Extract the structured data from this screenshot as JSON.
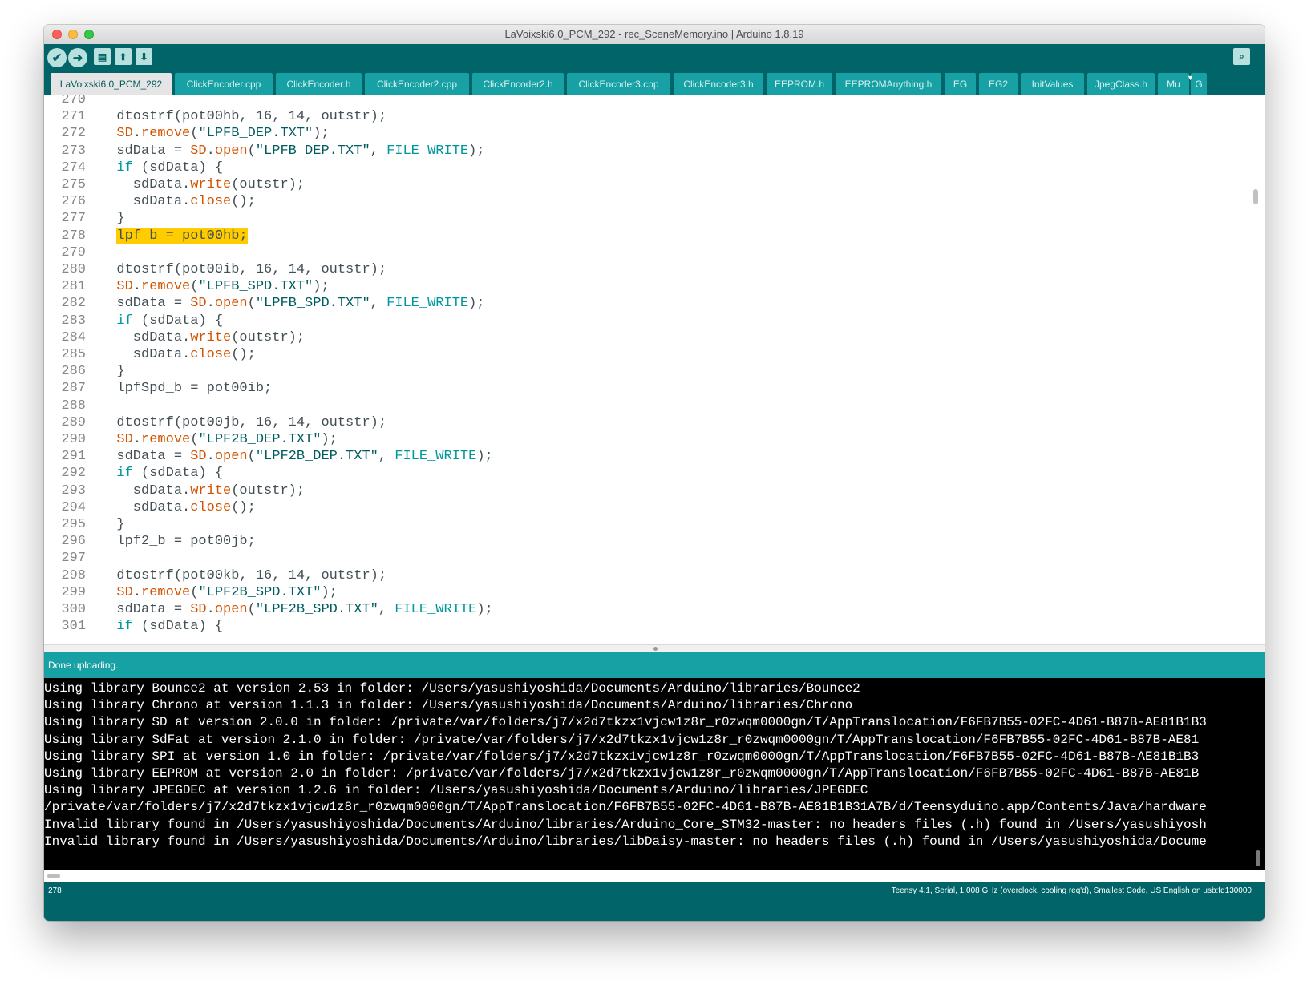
{
  "window": {
    "title": "LaVoixski6.0_PCM_292 - rec_SceneMemory.ino | Arduino 1.8.19"
  },
  "toolbar": {
    "verify_icon": "checkmark-icon",
    "upload_icon": "arrow-right-icon",
    "new_icon": "new-file-icon",
    "open_icon": "arrow-up-icon",
    "save_icon": "arrow-down-icon",
    "monitor_icon": "magnifier-icon",
    "accent": "#006468",
    "button_color": "#b8e0df"
  },
  "tabs": [
    "LaVoixski6.0_PCM_292",
    "ClickEncoder.cpp",
    "ClickEncoder.h",
    "ClickEncoder2.cpp",
    "ClickEncoder2.h",
    "ClickEncoder3.cpp",
    "ClickEncoder3.h",
    "EEPROM.h",
    "EEPROMAnything.h",
    "EG",
    "EG2",
    "InitValues",
    "JpegClass.h",
    "Mu",
    "G"
  ],
  "tab_menu_icon": "chevron-down-icon",
  "editor": {
    "lines": [
      {
        "n": "270",
        "t": ""
      },
      {
        "n": "271",
        "t": "  dtostrf(pot00hb, 16, 14, outstr);"
      },
      {
        "n": "272",
        "t": "  SD.remove(\"LPFB_DEP.TXT\");"
      },
      {
        "n": "273",
        "t": "  sdData = SD.open(\"LPFB_DEP.TXT\", FILE_WRITE);"
      },
      {
        "n": "274",
        "t": "  if (sdData) {"
      },
      {
        "n": "275",
        "t": "    sdData.write(outstr);"
      },
      {
        "n": "276",
        "t": "    sdData.close();"
      },
      {
        "n": "277",
        "t": "  }"
      },
      {
        "n": "278",
        "t": "  lpf_b = pot00hb;"
      },
      {
        "n": "279",
        "t": ""
      },
      {
        "n": "280",
        "t": "  dtostrf(pot00ib, 16, 14, outstr);"
      },
      {
        "n": "281",
        "t": "  SD.remove(\"LPFB_SPD.TXT\");"
      },
      {
        "n": "282",
        "t": "  sdData = SD.open(\"LPFB_SPD.TXT\", FILE_WRITE);"
      },
      {
        "n": "283",
        "t": "  if (sdData) {"
      },
      {
        "n": "284",
        "t": "    sdData.write(outstr);"
      },
      {
        "n": "285",
        "t": "    sdData.close();"
      },
      {
        "n": "286",
        "t": "  }"
      },
      {
        "n": "287",
        "t": "  lpfSpd_b = pot00ib;"
      },
      {
        "n": "288",
        "t": ""
      },
      {
        "n": "289",
        "t": "  dtostrf(pot00jb, 16, 14, outstr);"
      },
      {
        "n": "290",
        "t": "  SD.remove(\"LPF2B_DEP.TXT\");"
      },
      {
        "n": "291",
        "t": "  sdData = SD.open(\"LPF2B_DEP.TXT\", FILE_WRITE);"
      },
      {
        "n": "292",
        "t": "  if (sdData) {"
      },
      {
        "n": "293",
        "t": "    sdData.write(outstr);"
      },
      {
        "n": "294",
        "t": "    sdData.close();"
      },
      {
        "n": "295",
        "t": "  }"
      },
      {
        "n": "296",
        "t": "  lpf2_b = pot00jb;"
      },
      {
        "n": "297",
        "t": ""
      },
      {
        "n": "298",
        "t": "  dtostrf(pot00kb, 16, 14, outstr);"
      },
      {
        "n": "299",
        "t": "  SD.remove(\"LPF2B_SPD.TXT\");"
      },
      {
        "n": "300",
        "t": "  sdData = SD.open(\"LPF2B_SPD.TXT\", FILE_WRITE);"
      },
      {
        "n": "301",
        "t": "  if (sdData) {"
      }
    ],
    "highlighted_line": "278",
    "colors": {
      "function": "#d35400",
      "string": "#005c5f",
      "keyword": "#00979c",
      "text": "#434f54",
      "highlight": "#ffcc00"
    }
  },
  "status": {
    "message": "Done uploading."
  },
  "console": {
    "lines": [
      "Using library Bounce2 at version 2.53 in folder: /Users/yasushiyoshida/Documents/Arduino/libraries/Bounce2",
      "Using library Chrono at version 1.1.3 in folder: /Users/yasushiyoshida/Documents/Arduino/libraries/Chrono",
      "Using library SD at version 2.0.0 in folder: /private/var/folders/j7/x2d7tkzx1vjcw1z8r_r0zwqm0000gn/T/AppTranslocation/F6FB7B55-02FC-4D61-B87B-AE81B1B3",
      "Using library SdFat at version 2.1.0 in folder: /private/var/folders/j7/x2d7tkzx1vjcw1z8r_r0zwqm0000gn/T/AppTranslocation/F6FB7B55-02FC-4D61-B87B-AE81",
      "Using library SPI at version 1.0 in folder: /private/var/folders/j7/x2d7tkzx1vjcw1z8r_r0zwqm0000gn/T/AppTranslocation/F6FB7B55-02FC-4D61-B87B-AE81B1B3",
      "Using library EEPROM at version 2.0 in folder: /private/var/folders/j7/x2d7tkzx1vjcw1z8r_r0zwqm0000gn/T/AppTranslocation/F6FB7B55-02FC-4D61-B87B-AE81B",
      "Using library JPEGDEC at version 1.2.6 in folder: /Users/yasushiyoshida/Documents/Arduino/libraries/JPEGDEC",
      "/private/var/folders/j7/x2d7tkzx1vjcw1z8r_r0zwqm0000gn/T/AppTranslocation/F6FB7B55-02FC-4D61-B87B-AE81B1B31A7B/d/Teensyduino.app/Contents/Java/hardware",
      "Invalid library found in /Users/yasushiyoshida/Documents/Arduino/libraries/Arduino_Core_STM32-master: no headers files (.h) found in /Users/yasushiyosh",
      "Invalid library found in /Users/yasushiyoshida/Documents/Arduino/libraries/libDaisy-master: no headers files (.h) found in /Users/yasushiyoshida/Docume"
    ]
  },
  "bottombar": {
    "line_number": "278",
    "board_info": "Teensy 4.1, Serial, 1.008 GHz (overclock, cooling req'd), Smallest Code, US English on usb:fd130000"
  }
}
